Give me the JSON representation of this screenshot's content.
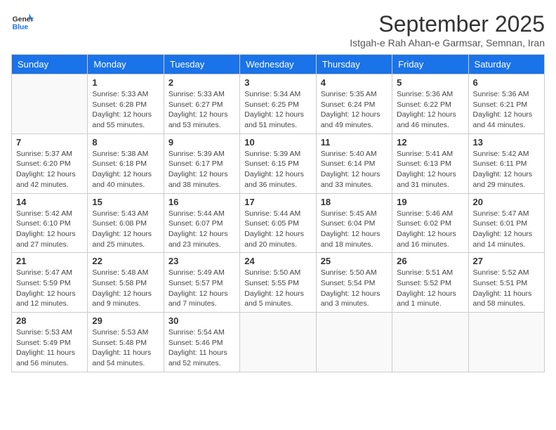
{
  "header": {
    "logo_general": "General",
    "logo_blue": "Blue",
    "title": "September 2025",
    "location": "Istgah-e Rah Ahan-e Garmsar, Semnan, Iran"
  },
  "weekdays": [
    "Sunday",
    "Monday",
    "Tuesday",
    "Wednesday",
    "Thursday",
    "Friday",
    "Saturday"
  ],
  "weeks": [
    [
      {
        "day": "",
        "info": ""
      },
      {
        "day": "1",
        "info": "Sunrise: 5:33 AM\nSunset: 6:28 PM\nDaylight: 12 hours\nand 55 minutes."
      },
      {
        "day": "2",
        "info": "Sunrise: 5:33 AM\nSunset: 6:27 PM\nDaylight: 12 hours\nand 53 minutes."
      },
      {
        "day": "3",
        "info": "Sunrise: 5:34 AM\nSunset: 6:25 PM\nDaylight: 12 hours\nand 51 minutes."
      },
      {
        "day": "4",
        "info": "Sunrise: 5:35 AM\nSunset: 6:24 PM\nDaylight: 12 hours\nand 49 minutes."
      },
      {
        "day": "5",
        "info": "Sunrise: 5:36 AM\nSunset: 6:22 PM\nDaylight: 12 hours\nand 46 minutes."
      },
      {
        "day": "6",
        "info": "Sunrise: 5:36 AM\nSunset: 6:21 PM\nDaylight: 12 hours\nand 44 minutes."
      }
    ],
    [
      {
        "day": "7",
        "info": "Sunrise: 5:37 AM\nSunset: 6:20 PM\nDaylight: 12 hours\nand 42 minutes."
      },
      {
        "day": "8",
        "info": "Sunrise: 5:38 AM\nSunset: 6:18 PM\nDaylight: 12 hours\nand 40 minutes."
      },
      {
        "day": "9",
        "info": "Sunrise: 5:39 AM\nSunset: 6:17 PM\nDaylight: 12 hours\nand 38 minutes."
      },
      {
        "day": "10",
        "info": "Sunrise: 5:39 AM\nSunset: 6:15 PM\nDaylight: 12 hours\nand 36 minutes."
      },
      {
        "day": "11",
        "info": "Sunrise: 5:40 AM\nSunset: 6:14 PM\nDaylight: 12 hours\nand 33 minutes."
      },
      {
        "day": "12",
        "info": "Sunrise: 5:41 AM\nSunset: 6:13 PM\nDaylight: 12 hours\nand 31 minutes."
      },
      {
        "day": "13",
        "info": "Sunrise: 5:42 AM\nSunset: 6:11 PM\nDaylight: 12 hours\nand 29 minutes."
      }
    ],
    [
      {
        "day": "14",
        "info": "Sunrise: 5:42 AM\nSunset: 6:10 PM\nDaylight: 12 hours\nand 27 minutes."
      },
      {
        "day": "15",
        "info": "Sunrise: 5:43 AM\nSunset: 6:08 PM\nDaylight: 12 hours\nand 25 minutes."
      },
      {
        "day": "16",
        "info": "Sunrise: 5:44 AM\nSunset: 6:07 PM\nDaylight: 12 hours\nand 23 minutes."
      },
      {
        "day": "17",
        "info": "Sunrise: 5:44 AM\nSunset: 6:05 PM\nDaylight: 12 hours\nand 20 minutes."
      },
      {
        "day": "18",
        "info": "Sunrise: 5:45 AM\nSunset: 6:04 PM\nDaylight: 12 hours\nand 18 minutes."
      },
      {
        "day": "19",
        "info": "Sunrise: 5:46 AM\nSunset: 6:02 PM\nDaylight: 12 hours\nand 16 minutes."
      },
      {
        "day": "20",
        "info": "Sunrise: 5:47 AM\nSunset: 6:01 PM\nDaylight: 12 hours\nand 14 minutes."
      }
    ],
    [
      {
        "day": "21",
        "info": "Sunrise: 5:47 AM\nSunset: 5:59 PM\nDaylight: 12 hours\nand 12 minutes."
      },
      {
        "day": "22",
        "info": "Sunrise: 5:48 AM\nSunset: 5:58 PM\nDaylight: 12 hours\nand 9 minutes."
      },
      {
        "day": "23",
        "info": "Sunrise: 5:49 AM\nSunset: 5:57 PM\nDaylight: 12 hours\nand 7 minutes."
      },
      {
        "day": "24",
        "info": "Sunrise: 5:50 AM\nSunset: 5:55 PM\nDaylight: 12 hours\nand 5 minutes."
      },
      {
        "day": "25",
        "info": "Sunrise: 5:50 AM\nSunset: 5:54 PM\nDaylight: 12 hours\nand 3 minutes."
      },
      {
        "day": "26",
        "info": "Sunrise: 5:51 AM\nSunset: 5:52 PM\nDaylight: 12 hours\nand 1 minute."
      },
      {
        "day": "27",
        "info": "Sunrise: 5:52 AM\nSunset: 5:51 PM\nDaylight: 11 hours\nand 58 minutes."
      }
    ],
    [
      {
        "day": "28",
        "info": "Sunrise: 5:53 AM\nSunset: 5:49 PM\nDaylight: 11 hours\nand 56 minutes."
      },
      {
        "day": "29",
        "info": "Sunrise: 5:53 AM\nSunset: 5:48 PM\nDaylight: 11 hours\nand 54 minutes."
      },
      {
        "day": "30",
        "info": "Sunrise: 5:54 AM\nSunset: 5:46 PM\nDaylight: 11 hours\nand 52 minutes."
      },
      {
        "day": "",
        "info": ""
      },
      {
        "day": "",
        "info": ""
      },
      {
        "day": "",
        "info": ""
      },
      {
        "day": "",
        "info": ""
      }
    ]
  ]
}
